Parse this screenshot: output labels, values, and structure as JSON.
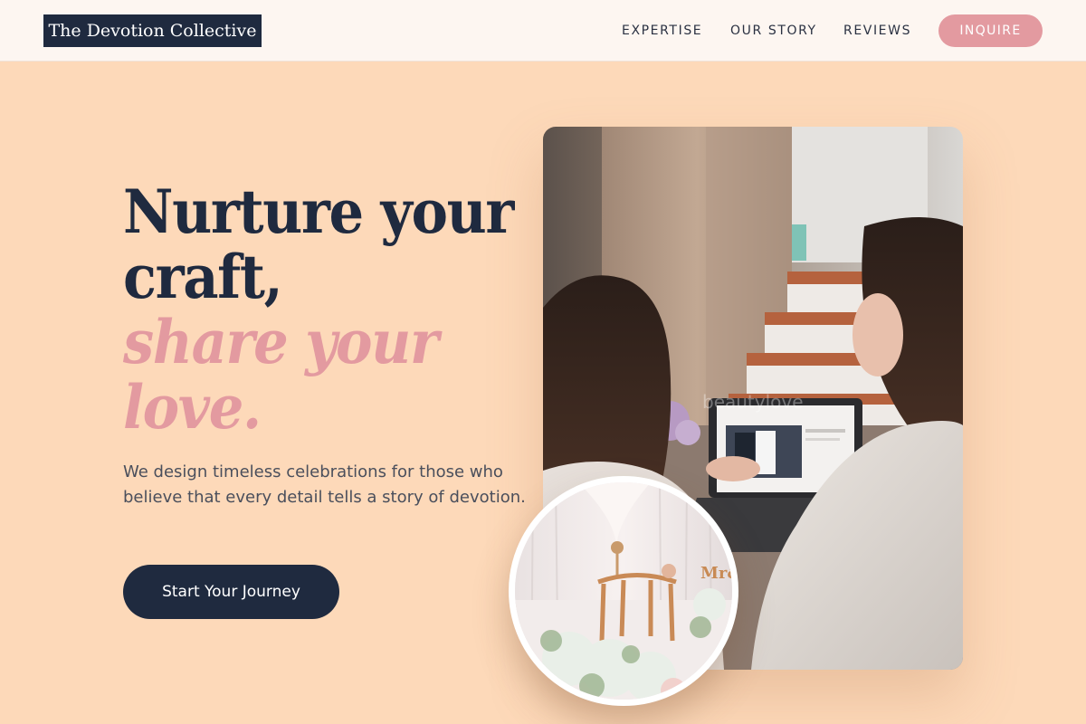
{
  "header": {
    "logo_text": "The Devotion Collective",
    "nav": [
      {
        "label": "EXPERTISE"
      },
      {
        "label": "OUR STORY"
      },
      {
        "label": "REVIEWS"
      }
    ],
    "inquire_label": "INQUIRE"
  },
  "hero": {
    "headline_line1": "Nurture your",
    "headline_line2": "craft,",
    "headline_accent1": "share your",
    "headline_accent2": "love.",
    "subtext": "We design timeless celebrations for those who believe that every detail tells a story of devotion.",
    "cta_label": "Start Your Journey",
    "photo_overlay_text": "beautylove",
    "circle_sign_text": "Mr&"
  },
  "colors": {
    "background": "#FDD9B9",
    "header_bg": "#FDF6F1",
    "navy": "#1F2A3F",
    "accent_pink": "#E39AA0"
  }
}
